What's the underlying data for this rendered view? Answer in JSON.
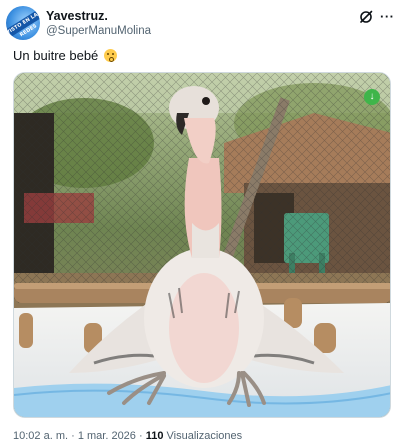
{
  "author": {
    "name": "Yavestruz.",
    "handle": "@SuperManuMolina",
    "avatar_text": "VISTO EN LAS REDES"
  },
  "header_icons": [
    "grok-icon",
    "more-icon"
  ],
  "more_glyph": "···",
  "tweet": {
    "text": "Un buitre bebé",
    "emoji": "flushed-face-emoji"
  },
  "media": {
    "badge_icon": "download-icon"
  },
  "meta": {
    "time": "10:02 a. m.",
    "separator": " · ",
    "date": "1 mar. 2026",
    "views_count": "110",
    "views_label": "Visualizaciones"
  },
  "colors": {
    "text": "#0f1419",
    "secondary": "#536471",
    "border": "#cfd9de"
  }
}
